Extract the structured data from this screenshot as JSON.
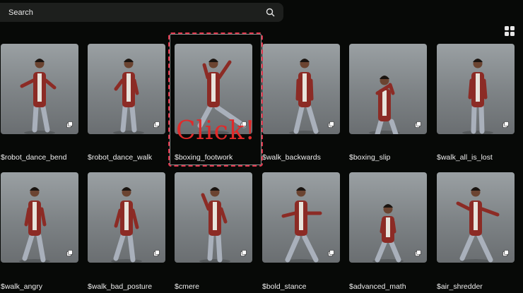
{
  "search": {
    "placeholder": "Search"
  },
  "annotation": {
    "text": "Click!"
  },
  "accent": "#e0344b",
  "tiles": [
    {
      "label": "$robot_dance_bend"
    },
    {
      "label": "$robot_dance_walk"
    },
    {
      "label": "$boxing_footwork"
    },
    {
      "label": "$walk_backwards"
    },
    {
      "label": "$boxing_slip"
    },
    {
      "label": "$walk_all_is_lost"
    },
    {
      "label": "$walk_angry"
    },
    {
      "label": "$walk_bad_posture"
    },
    {
      "label": "$cmere"
    },
    {
      "label": "$bold_stance"
    },
    {
      "label": "$advanced_math"
    },
    {
      "label": "$air_shredder"
    }
  ]
}
